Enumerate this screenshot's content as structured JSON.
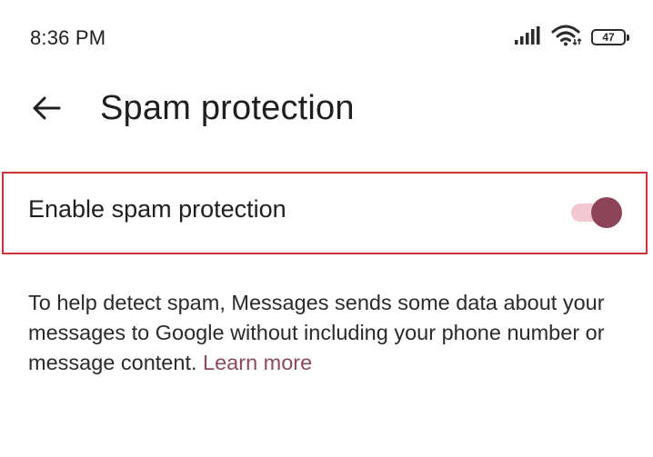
{
  "status_bar": {
    "time": "8:36 PM",
    "battery_level": "47",
    "icons": [
      "signal-icon",
      "wifi-icon",
      "battery-icon"
    ]
  },
  "app_bar": {
    "back_icon": "arrow-back-icon",
    "title": "Spam protection"
  },
  "setting": {
    "label": "Enable spam protection",
    "toggle_state": "on",
    "toggle_colors": {
      "track": "#f4c8d2",
      "thumb": "#8e4458"
    },
    "highlight_color": "#c8323a"
  },
  "description": {
    "text": "To help detect spam, Messages sends some data about your messages to Google without including your phone number or message content.",
    "link": "Learn more",
    "link_color": "#8a4a5c"
  }
}
